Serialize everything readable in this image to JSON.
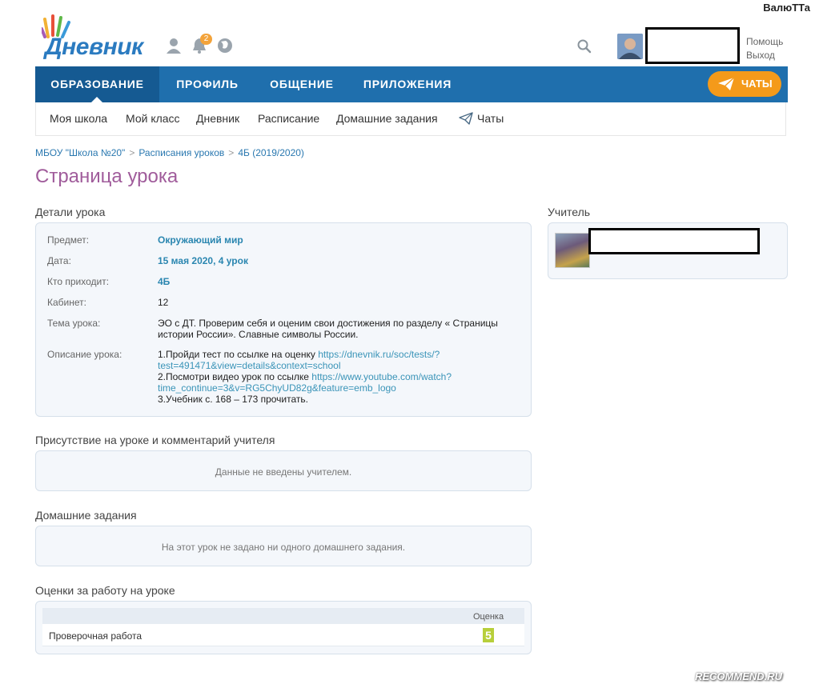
{
  "watermark_top": "ВалюТТа",
  "watermark_bottom": "RECOMMEND.RU",
  "header": {
    "logo_text": "Дневник",
    "notification_count": "2",
    "help_label": "Помощь",
    "logout_label": "Выход"
  },
  "nav": {
    "items": [
      "ОБРАЗОВАНИЕ",
      "ПРОФИЛЬ",
      "ОБЩЕНИЕ",
      "ПРИЛОЖЕНИЯ"
    ],
    "chats_label": "ЧАТЫ"
  },
  "subnav": {
    "items": [
      "Моя школа",
      "Мой класс",
      "Дневник",
      "Расписание",
      "Домашние задания",
      "Чаты"
    ]
  },
  "breadcrumb": [
    "МБОУ \"Школа №20\"",
    "Расписания уроков",
    "4Б (2019/2020)"
  ],
  "page_title": "Страница урока",
  "lesson_details": {
    "title": "Детали урока",
    "subject_label": "Предмет:",
    "subject_value": "Окружающий мир",
    "date_label": "Дата:",
    "date_value": "15 мая 2020, 4 урок",
    "who_label": "Кто приходит:",
    "who_value": "4Б",
    "room_label": "Кабинет:",
    "room_value": "12",
    "topic_label": "Тема урока:",
    "topic_line1": "ЭО с ДТ. Проверим себя и оценим свои достижения по разделу « Страницы",
    "topic_line2": "истории России». Славные символы России.",
    "desc_label": "Описание урока:",
    "desc_1_text": "1.Пройди тест по ссылке на оценку ",
    "desc_1_url_a": "https://dnevnik.ru/soc/tests/?",
    "desc_1_url_b": "test=491471&view=details&context=school",
    "desc_2_text": "2.Посмотри видео урок по ссылке ",
    "desc_2_url_a": "https://www.youtube.com/watch?",
    "desc_2_url_b": "time_continue=3&v=RG5ChyUD82g&feature=emb_logo",
    "desc_3_text": "3.Учебник с. 168 – 173 прочитать."
  },
  "attendance": {
    "title": "Присутствие на уроке и комментарий учителя",
    "empty": "Данные не введены учителем."
  },
  "homework": {
    "title": "Домашние задания",
    "empty": "На этот урок не задано ни одного домашнего задания."
  },
  "grades": {
    "title": "Оценки за работу на уроке",
    "column_label": "Оценка",
    "rows": [
      {
        "work": "Проверочная работа",
        "grade": "5"
      }
    ]
  },
  "teacher": {
    "title": "Учитель"
  },
  "colors": {
    "nav_blue": "#1f6fad",
    "nav_active": "#155a92",
    "chats_orange": "#f49a1a",
    "title_purple": "#a05c9b",
    "link_blue": "#2a86b0",
    "grade_green": "#b7cf3a"
  }
}
